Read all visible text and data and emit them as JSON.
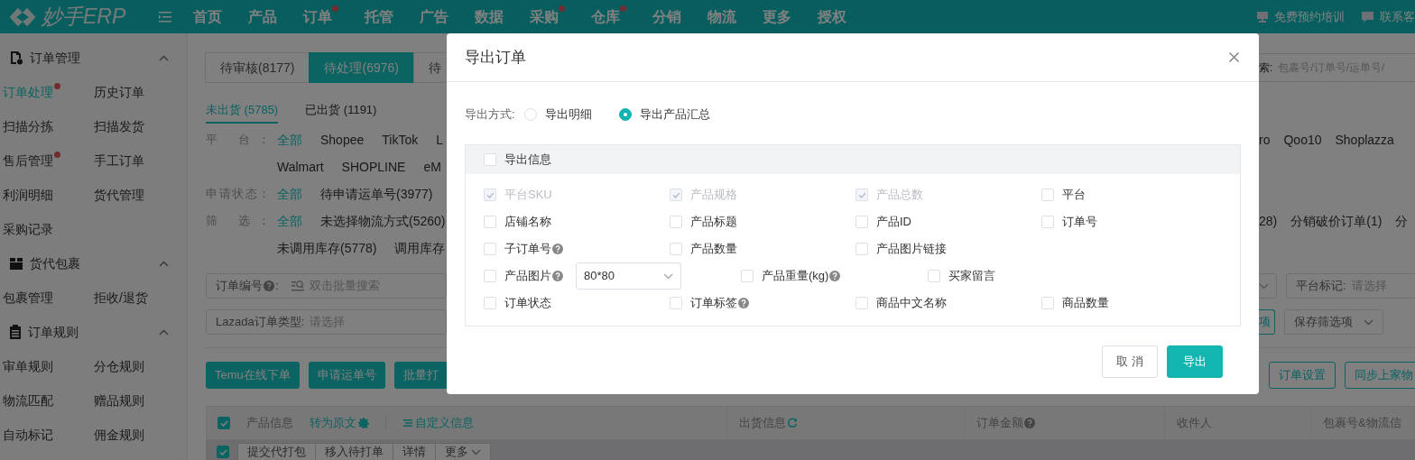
{
  "nav": {
    "logo": "妙手ERP",
    "items": [
      {
        "label": "首页",
        "dot": false
      },
      {
        "label": "产品",
        "dot": false
      },
      {
        "label": "订单",
        "dot": true
      },
      {
        "label": "托管",
        "dot": false
      },
      {
        "label": "广告",
        "dot": false
      },
      {
        "label": "数据",
        "dot": false
      },
      {
        "label": "采购",
        "dot": true
      },
      {
        "label": "仓库",
        "dot": true
      },
      {
        "label": "分销",
        "dot": false
      },
      {
        "label": "物流",
        "dot": false
      },
      {
        "label": "更多",
        "dot": false
      },
      {
        "label": "授权",
        "dot": false
      }
    ],
    "right": [
      {
        "label": "免费预约培训"
      },
      {
        "label": "联系客"
      }
    ]
  },
  "sidebar": {
    "sections": [
      {
        "title": "订单管理",
        "expanded": true,
        "items": [
          {
            "label": "订单处理",
            "selected": true,
            "dot": true
          },
          {
            "label": "历史订单",
            "selected": false,
            "dot": false
          },
          {
            "label": "扫描分拣",
            "selected": false,
            "dot": false
          },
          {
            "label": "扫描发货",
            "selected": false,
            "dot": false
          },
          {
            "label": "售后管理",
            "selected": false,
            "dot": true
          },
          {
            "label": "手工订单",
            "selected": false,
            "dot": false
          },
          {
            "label": "利润明细",
            "selected": false,
            "dot": false
          },
          {
            "label": "货代管理",
            "selected": false,
            "dot": false
          },
          {
            "label": "采购记录",
            "selected": false,
            "dot": false
          }
        ]
      },
      {
        "title": "货代包裹",
        "expanded": true,
        "items": [
          {
            "label": "包裹管理",
            "selected": false,
            "dot": false
          },
          {
            "label": "拒收/退货",
            "selected": false,
            "dot": false
          }
        ]
      },
      {
        "title": "订单规则",
        "expanded": true,
        "items": [
          {
            "label": "审单规则",
            "selected": false,
            "dot": false
          },
          {
            "label": "分仓规则",
            "selected": false,
            "dot": false
          },
          {
            "label": "物流匹配",
            "selected": false,
            "dot": false
          },
          {
            "label": "赠品规则",
            "selected": false,
            "dot": false
          },
          {
            "label": "自动标记",
            "selected": false,
            "dot": false
          },
          {
            "label": "佣金规则",
            "selected": false,
            "dot": false
          }
        ]
      }
    ]
  },
  "status_tabs": [
    {
      "label": "待审核(8177)",
      "selected": false
    },
    {
      "label": "待处理(6976)",
      "selected": true
    },
    {
      "label": "待",
      "selected": false
    }
  ],
  "search": {
    "label": "索:",
    "placeholder": "包裹号/订单号/运单号/"
  },
  "ship_tabs": [
    {
      "label": "未出货 (5785)",
      "selected": true
    },
    {
      "label": "已出货 (1191)",
      "selected": false
    }
  ],
  "filters": [
    {
      "label": "平 台：",
      "options": [
        {
          "label": "全部",
          "selected": true
        },
        {
          "label": "Shopee",
          "selected": false
        },
        {
          "label": "TikTok",
          "selected": false
        },
        {
          "label": "L",
          "selected": false
        }
      ],
      "options_right": [
        {
          "label": "ro",
          "selected": false
        },
        {
          "label": "Qoo10",
          "selected": false
        },
        {
          "label": "Shoplazza",
          "selected": false
        }
      ]
    },
    {
      "options": [
        {
          "label": "Walmart",
          "selected": false
        },
        {
          "label": "SHOPLINE",
          "selected": false
        },
        {
          "label": "eM",
          "selected": false
        }
      ]
    },
    {
      "label": "申请状态：",
      "options": [
        {
          "label": "全部",
          "selected": true
        },
        {
          "label": "待申请运单号(3977)",
          "selected": false
        }
      ]
    },
    {
      "label": "筛 选：",
      "options": [
        {
          "label": "全部",
          "selected": true
        },
        {
          "label": "未选择物流方式(5260)",
          "selected": false
        }
      ],
      "options_right": [
        {
          "label": "28)",
          "selected": false
        },
        {
          "label": "分销破价订单(1)",
          "selected": false
        },
        {
          "label": "分",
          "selected": false
        }
      ]
    },
    {
      "options": [
        {
          "label": "未调用库存(5778)",
          "selected": false
        },
        {
          "label": "调用库存",
          "selected": false
        }
      ]
    }
  ],
  "search_fields": [
    {
      "label": "订单编号",
      "help": true,
      "suffix": ":",
      "placeholder": "双击批量搜索"
    },
    {
      "label": "Lazada订单类型:",
      "placeholder": "请选择"
    }
  ],
  "platform_mark": {
    "label": "平台标记:",
    "placeholder": "请选择"
  },
  "filter_buttons": [
    {
      "label": "项",
      "dropdown": false
    },
    {
      "label": "保存筛选项",
      "dropdown": true
    }
  ],
  "actions": [
    "Temu在线下单",
    "申请运单号",
    "批量打"
  ],
  "actions_right": [
    "订单设置",
    "同步上家物"
  ],
  "table": {
    "checked": true,
    "header_links": [
      {
        "label": "转为原文"
      },
      {
        "label": "自定义信息"
      }
    ],
    "columns": [
      {
        "label": "产品信息"
      },
      {
        "label": "出货信息"
      },
      {
        "label": "订单金额",
        "help": true
      },
      {
        "label": "收件人"
      },
      {
        "label": "包裹号&物流信"
      }
    ],
    "batch_row": {
      "checked": true,
      "actions": [
        {
          "label": "提交代打包",
          "dropdown": false
        },
        {
          "label": "移入待打单",
          "dropdown": false
        },
        {
          "label": "详情",
          "dropdown": false
        },
        {
          "label": "更多",
          "dropdown": true
        }
      ]
    }
  },
  "dialog": {
    "title": "导出订单",
    "mode": {
      "label": "导出方式:",
      "options": [
        {
          "label": "导出明细",
          "selected": false
        },
        {
          "label": "导出产品汇总",
          "selected": true
        }
      ]
    },
    "fields": {
      "header": {
        "label": "导出信息",
        "checked": false
      },
      "rows": [
        {
          "kind": "grid",
          "items": [
            {
              "label": "平台SKU",
              "checked": true,
              "disabled": true
            },
            {
              "label": "产品规格",
              "checked": true,
              "disabled": true
            },
            {
              "label": "产品总数",
              "checked": true,
              "disabled": true
            },
            {
              "label": "平台",
              "checked": false,
              "disabled": false
            }
          ]
        },
        {
          "kind": "grid",
          "items": [
            {
              "label": "店铺名称",
              "checked": false,
              "disabled": false
            },
            {
              "label": "产品标题",
              "checked": false,
              "disabled": false
            },
            {
              "label": "产品ID",
              "checked": false,
              "disabled": false
            },
            {
              "label": "订单号",
              "checked": false,
              "disabled": false
            }
          ]
        },
        {
          "kind": "grid",
          "items": [
            {
              "label": "子订单号",
              "checked": false,
              "disabled": false,
              "help": true
            },
            {
              "label": "产品数量",
              "checked": false,
              "disabled": false
            },
            {
              "label": "产品图片链接",
              "checked": false,
              "disabled": false
            }
          ]
        },
        {
          "kind": "inline",
          "items": [
            {
              "label": "产品图片",
              "checked": false,
              "disabled": false,
              "help": true,
              "select": "80*80"
            },
            {
              "label": "产品重量(kg)",
              "checked": false,
              "disabled": false,
              "help": true
            },
            {
              "label": "买家留言",
              "checked": false,
              "disabled": false
            }
          ]
        },
        {
          "kind": "grid",
          "items": [
            {
              "label": "订单状态",
              "checked": false,
              "disabled": false
            },
            {
              "label": "订单标签",
              "checked": false,
              "disabled": false,
              "help": true
            },
            {
              "label": "商品中文名称",
              "checked": false,
              "disabled": false
            },
            {
              "label": "商品数量",
              "checked": false,
              "disabled": false
            }
          ]
        }
      ]
    },
    "buttons": [
      {
        "label": "取 消",
        "kind": "secondary"
      },
      {
        "label": "导出",
        "kind": "primary"
      }
    ]
  }
}
